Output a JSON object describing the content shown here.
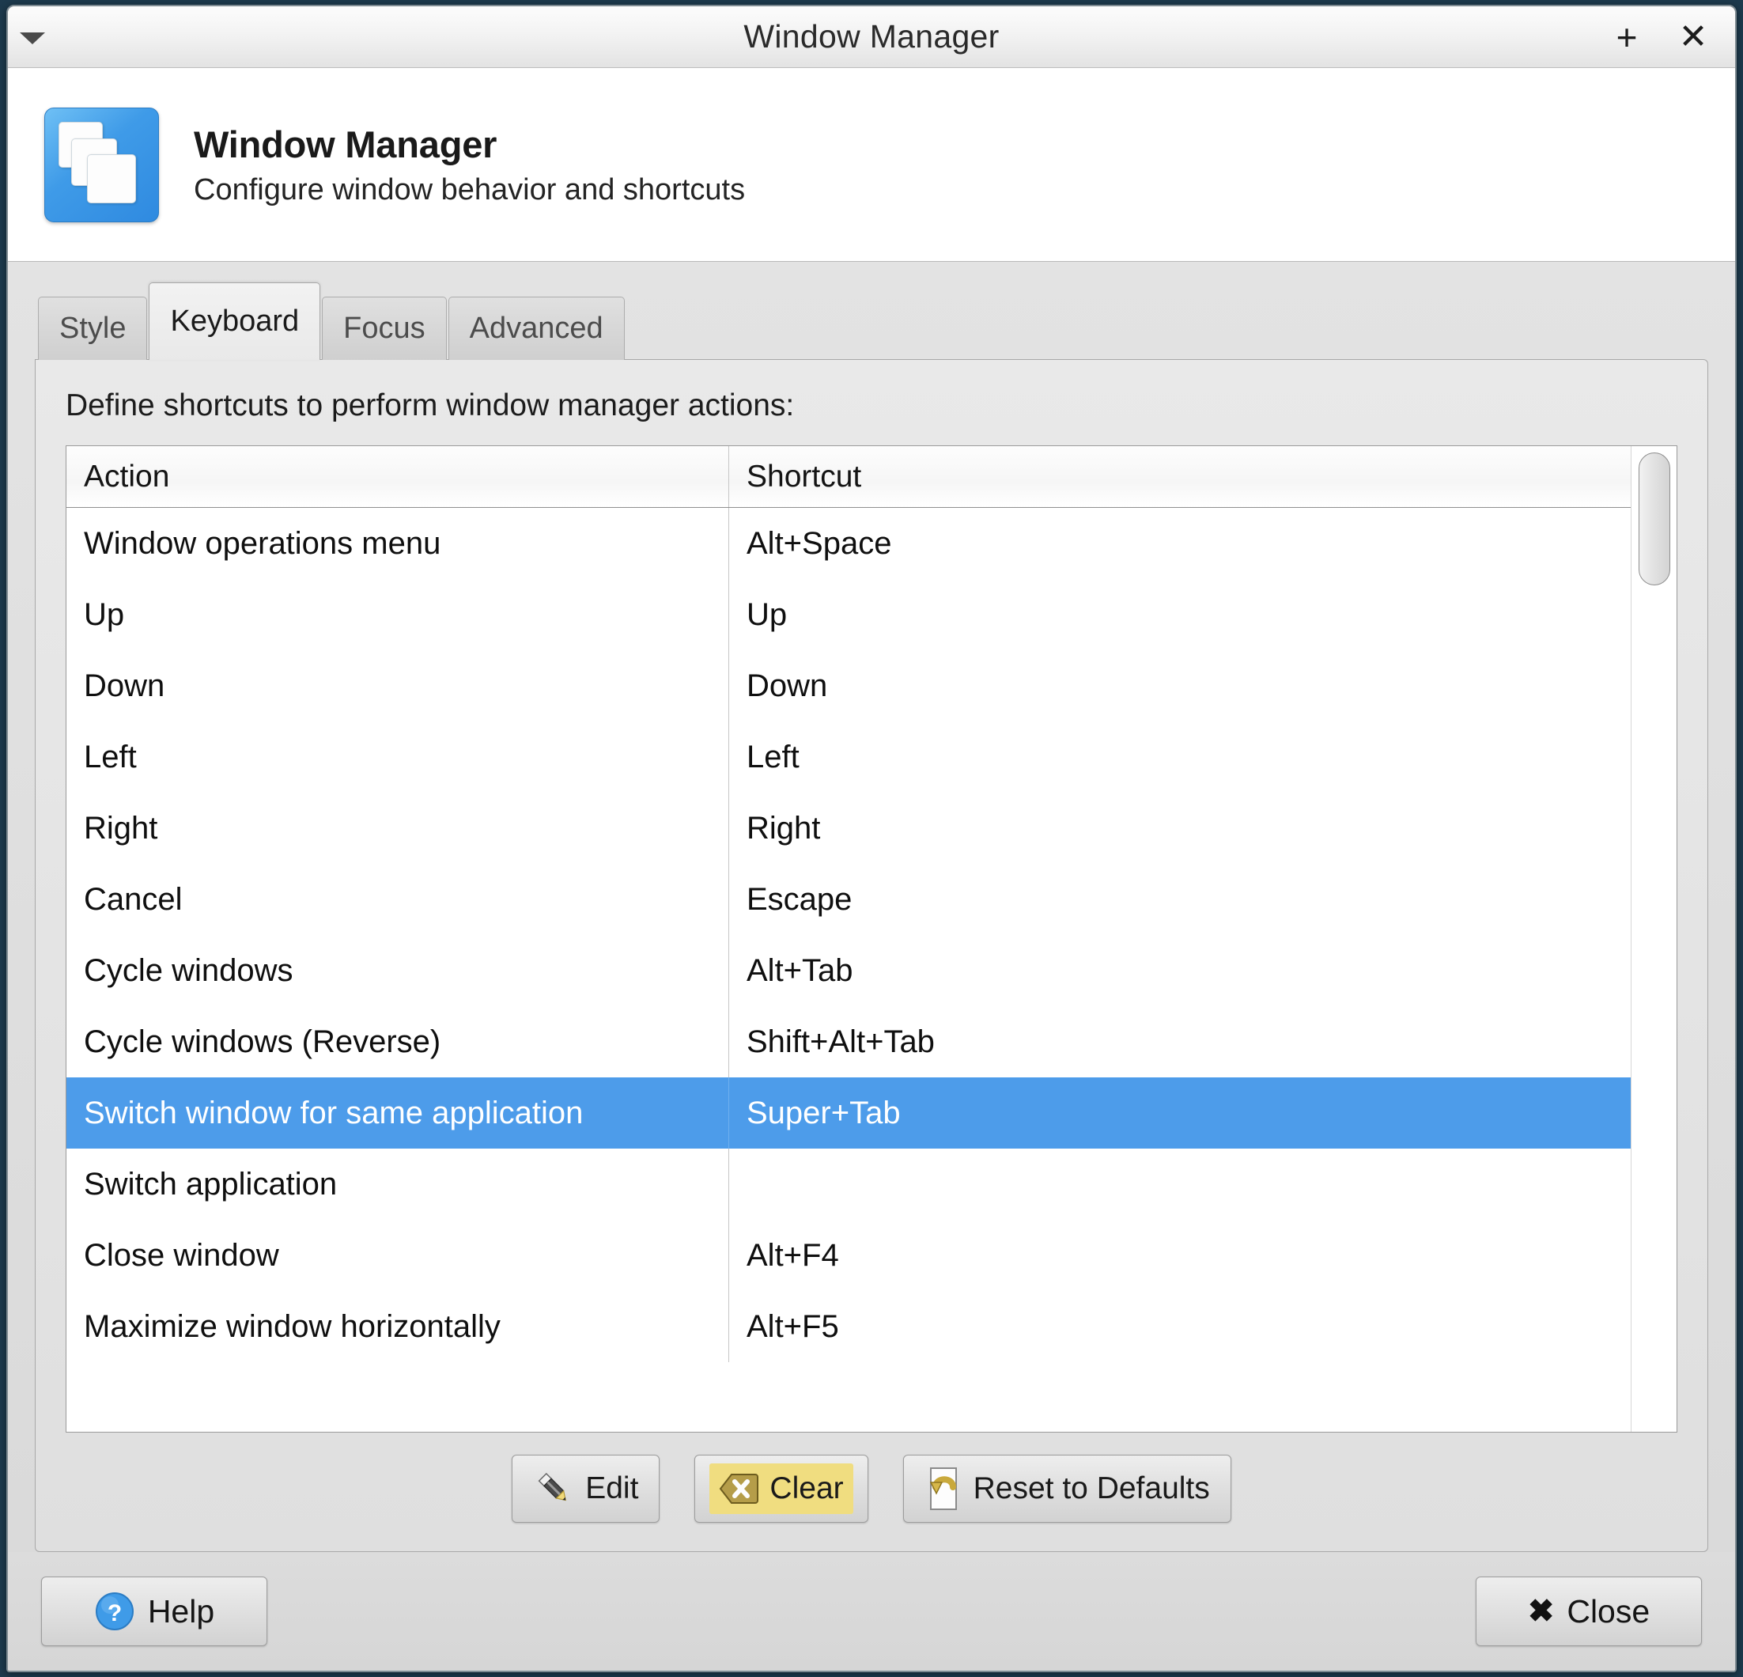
{
  "window": {
    "title": "Window Manager",
    "menu_icon": "chevron-down-icon",
    "maximize_label": "+",
    "close_label": "✕"
  },
  "header": {
    "icon": "window-manager-icon",
    "title": "Window Manager",
    "subtitle": "Configure window behavior and shortcuts"
  },
  "tabs": [
    {
      "label": "Style",
      "active": false
    },
    {
      "label": "Keyboard",
      "active": true
    },
    {
      "label": "Focus",
      "active": false
    },
    {
      "label": "Advanced",
      "active": false
    }
  ],
  "panel": {
    "description": "Define shortcuts to perform window manager actions:",
    "columns": {
      "action": "Action",
      "shortcut": "Shortcut"
    },
    "rows": [
      {
        "action": "Window operations menu",
        "shortcut": "Alt+Space",
        "selected": false
      },
      {
        "action": "Up",
        "shortcut": "Up",
        "selected": false
      },
      {
        "action": "Down",
        "shortcut": "Down",
        "selected": false
      },
      {
        "action": "Left",
        "shortcut": "Left",
        "selected": false
      },
      {
        "action": "Right",
        "shortcut": "Right",
        "selected": false
      },
      {
        "action": "Cancel",
        "shortcut": "Escape",
        "selected": false
      },
      {
        "action": "Cycle windows",
        "shortcut": "Alt+Tab",
        "selected": false
      },
      {
        "action": "Cycle windows (Reverse)",
        "shortcut": "Shift+Alt+Tab",
        "selected": false
      },
      {
        "action": "Switch window for same application",
        "shortcut": "Super+Tab",
        "selected": true
      },
      {
        "action": "Switch application",
        "shortcut": "",
        "selected": false
      },
      {
        "action": "Close window",
        "shortcut": "Alt+F4",
        "selected": false
      },
      {
        "action": "Maximize window horizontally",
        "shortcut": "Alt+F5",
        "selected": false
      }
    ]
  },
  "actions": {
    "edit": {
      "label": "Edit",
      "icon": "pencil-icon",
      "focused": false
    },
    "clear": {
      "label": "Clear",
      "icon": "clear-icon",
      "focused": true
    },
    "reset": {
      "label": "Reset to Defaults",
      "icon": "undo-icon",
      "focused": false
    }
  },
  "footer": {
    "help": {
      "label": "Help",
      "icon": "question-mark-icon"
    },
    "close": {
      "label": "Close",
      "icon": "close-x-icon"
    }
  },
  "colors": {
    "selection_blue": "#4d9cea",
    "focus_yellow": "#f0dd80",
    "accent_icon_blue": "#3f9be8"
  }
}
